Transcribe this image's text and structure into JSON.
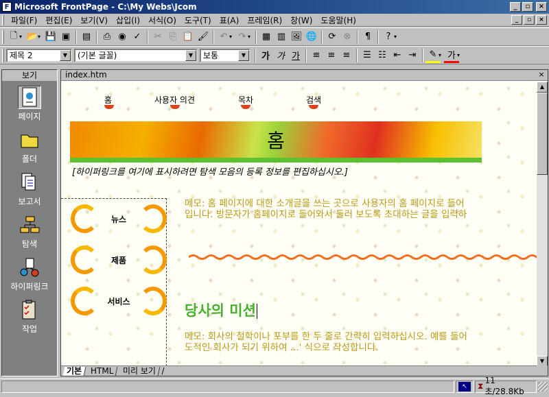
{
  "window": {
    "title": "Microsoft FrontPage - C:\\My Webs\\Jcom",
    "minimize": "_",
    "maximize": "▫",
    "close": "×"
  },
  "menu": {
    "items": [
      "파일(F)",
      "편집(E)",
      "보기(V)",
      "삽입(I)",
      "서식(O)",
      "도구(T)",
      "표(A)",
      "프레임(R)",
      "창(W)",
      "도움말(H)"
    ],
    "mdi_min": "_",
    "mdi_restore": "▫",
    "mdi_close": "×"
  },
  "format_toolbar": {
    "style": "제목 2",
    "font": "(기본 글꼴)",
    "size": "보통",
    "bold": "가",
    "italic": "가",
    "underline": "가",
    "font_color": "가"
  },
  "views_bar": {
    "header": "보기",
    "items": [
      {
        "label": "페이지",
        "icon": "page-view-icon",
        "active": true
      },
      {
        "label": "폴더",
        "icon": "folder-icon",
        "active": false
      },
      {
        "label": "보고서",
        "icon": "reports-icon",
        "active": false
      },
      {
        "label": "탐색",
        "icon": "navigation-icon",
        "active": false
      },
      {
        "label": "하이퍼링크",
        "icon": "hyperlinks-icon",
        "active": false
      },
      {
        "label": "작업",
        "icon": "tasks-icon",
        "active": false
      }
    ]
  },
  "document": {
    "tab": "index.htm",
    "close": "×",
    "nav_links": [
      "홈",
      "사용자 의견",
      "목차",
      "검색"
    ],
    "banner_title": "홈",
    "banner_note": "[하이퍼링크를 여기에 표시하려면 탐색 모음의 등록 정보를 편집하십시오.]",
    "side_buttons": [
      "뉴스",
      "제품",
      "서비스"
    ],
    "memo1_line1": "메모: 홈 페이지에 대한 소개글을 쓰는 곳으로 사용자의 홈 페이지로 들어",
    "memo1_line2": "입니다. 방문자가 홈페이지로 들어와서 둘러 보도록 초대하는 글을 입력하",
    "mission_heading": "당사의 미션",
    "memo2_line1": "메모: 회사의 철학이나 포부를 한 두 줄로 간략히 입력하십시오. 예를 들어",
    "memo2_line2": "도적인 회사가 되기 위하여 ...' 식으로 작성합니다.",
    "view_tabs": [
      {
        "label": "기본",
        "active": true
      },
      {
        "label": "HTML",
        "active": false
      },
      {
        "label": "미리 보기",
        "active": false
      }
    ]
  },
  "status": {
    "download_time": "11초/28.8Kb"
  },
  "colors": {
    "title_bar": "#0a246a",
    "memo_text": "#b89a1a",
    "heading_green": "#46b02e",
    "accent_orange": "#f49a00"
  }
}
